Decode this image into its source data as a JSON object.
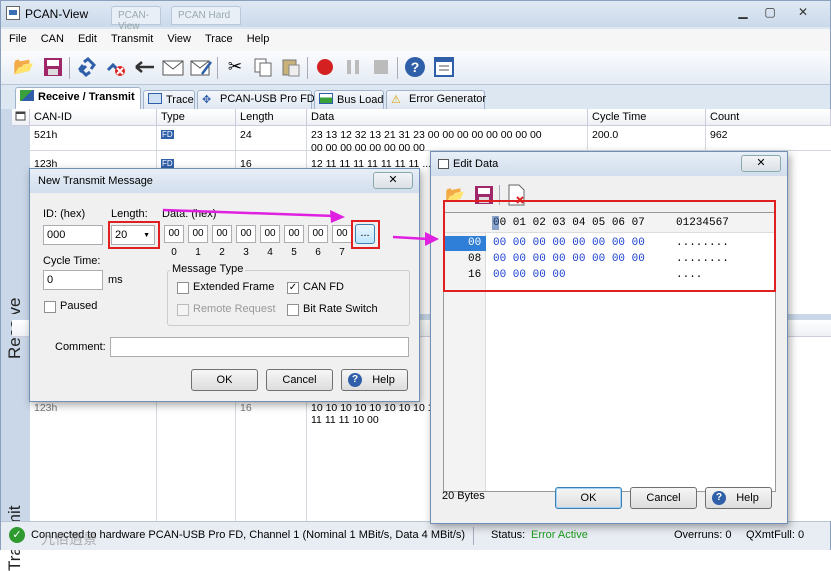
{
  "window": {
    "title": "PCAN-View",
    "ghost_tabs": [
      "PCAN-View",
      "PCAN Hard"
    ]
  },
  "menu": [
    "File",
    "CAN",
    "Edit",
    "Transmit",
    "View",
    "Trace",
    "Help"
  ],
  "toolbar_icons": [
    "connect-folder-icon",
    "save-icon",
    "link-icon",
    "disconnect-icon",
    "back-arrow-icon",
    "envelope-icon",
    "envelope-edit-icon",
    "cut-icon",
    "copy-icon",
    "paste-icon",
    "record-icon",
    "pause-icon",
    "stop-icon",
    "help-icon",
    "properties-icon"
  ],
  "tabs": [
    {
      "label": "Receive / Transmit"
    },
    {
      "label": "Trace"
    },
    {
      "label": "PCAN-USB Pro FD"
    },
    {
      "label": "Bus Load"
    },
    {
      "label": "Error Generator"
    }
  ],
  "side": {
    "receive": "Receive",
    "transmit": "Transmit"
  },
  "grid": {
    "headers": [
      "CAN-ID",
      "Type",
      "Length",
      "Data",
      "Cycle Time",
      "Count"
    ],
    "rows": [
      {
        "id": "521h",
        "type": "FD",
        "length": "24",
        "data1": "23 13 12 32 13 21 31 23 00 00 00 00 00 00 00 00",
        "data2": "00 00 00 00 00 00 00 00",
        "cycle": "200.0",
        "count": "962"
      },
      {
        "id": "123h",
        "type": "FD",
        "length": "16",
        "data1": "12 11 11 11 11 11 11 11 ..."
      }
    ],
    "transmit_row": {
      "id": "123h",
      "length": "16",
      "data1": "10 10 10 10 10 10 10 10 10",
      "data2": "11 11 11 10 00"
    }
  },
  "status": {
    "connection": "Connected to hardware PCAN-USB Pro FD, Channel 1 (Nominal 1 MBit/s, Data 4 MBit/s)",
    "status_label": "Status:",
    "status_value": "Error Active",
    "overruns": "Overruns: 0",
    "qxmtfull": "QXmtFull: 0",
    "watermark": "九佰逍景"
  },
  "ntm": {
    "title": "New Transmit Message",
    "close": "✕",
    "id_label": "ID: (hex)",
    "id_value": "000",
    "length_label": "Length:",
    "length_value": "20",
    "data_label": "Data: (hex)",
    "bytes": [
      "00",
      "00",
      "00",
      "00",
      "00",
      "00",
      "00",
      "00"
    ],
    "byte_indices": [
      "0",
      "1",
      "2",
      "3",
      "4",
      "5",
      "6",
      "7"
    ],
    "ellipsis": "...",
    "cycle_label": "Cycle Time:",
    "cycle_value": "0",
    "cycle_unit": "ms",
    "paused": "Paused",
    "msgtype_label": "Message Type",
    "extended": "Extended Frame",
    "canfd": "CAN FD",
    "remote": "Remote Request",
    "brs": "Bit Rate Switch",
    "comment_label": "Comment:",
    "ok": "OK",
    "cancel": "Cancel",
    "help": "Help"
  },
  "edit": {
    "title": "Edit Data",
    "close": "✕",
    "col_header": "00 01 02 03 04 05 06 07",
    "ascii_header": "01234567",
    "rows": [
      {
        "off": "00",
        "hex": "00 00 00 00 00 00 00 00",
        "ascii": "........"
      },
      {
        "off": "08",
        "hex": "00 00 00 00 00 00 00 00",
        "ascii": "........"
      },
      {
        "off": "16",
        "hex": "00 00 00 00",
        "ascii": "...."
      }
    ],
    "bytes_label": "20 Bytes",
    "ok": "OK",
    "cancel": "Cancel",
    "help": "Help"
  },
  "colors": {
    "accent": "#3b6fb6",
    "highlight": "#e02020",
    "arrow": "#e020e0",
    "error_active": "#1a9a1a"
  }
}
